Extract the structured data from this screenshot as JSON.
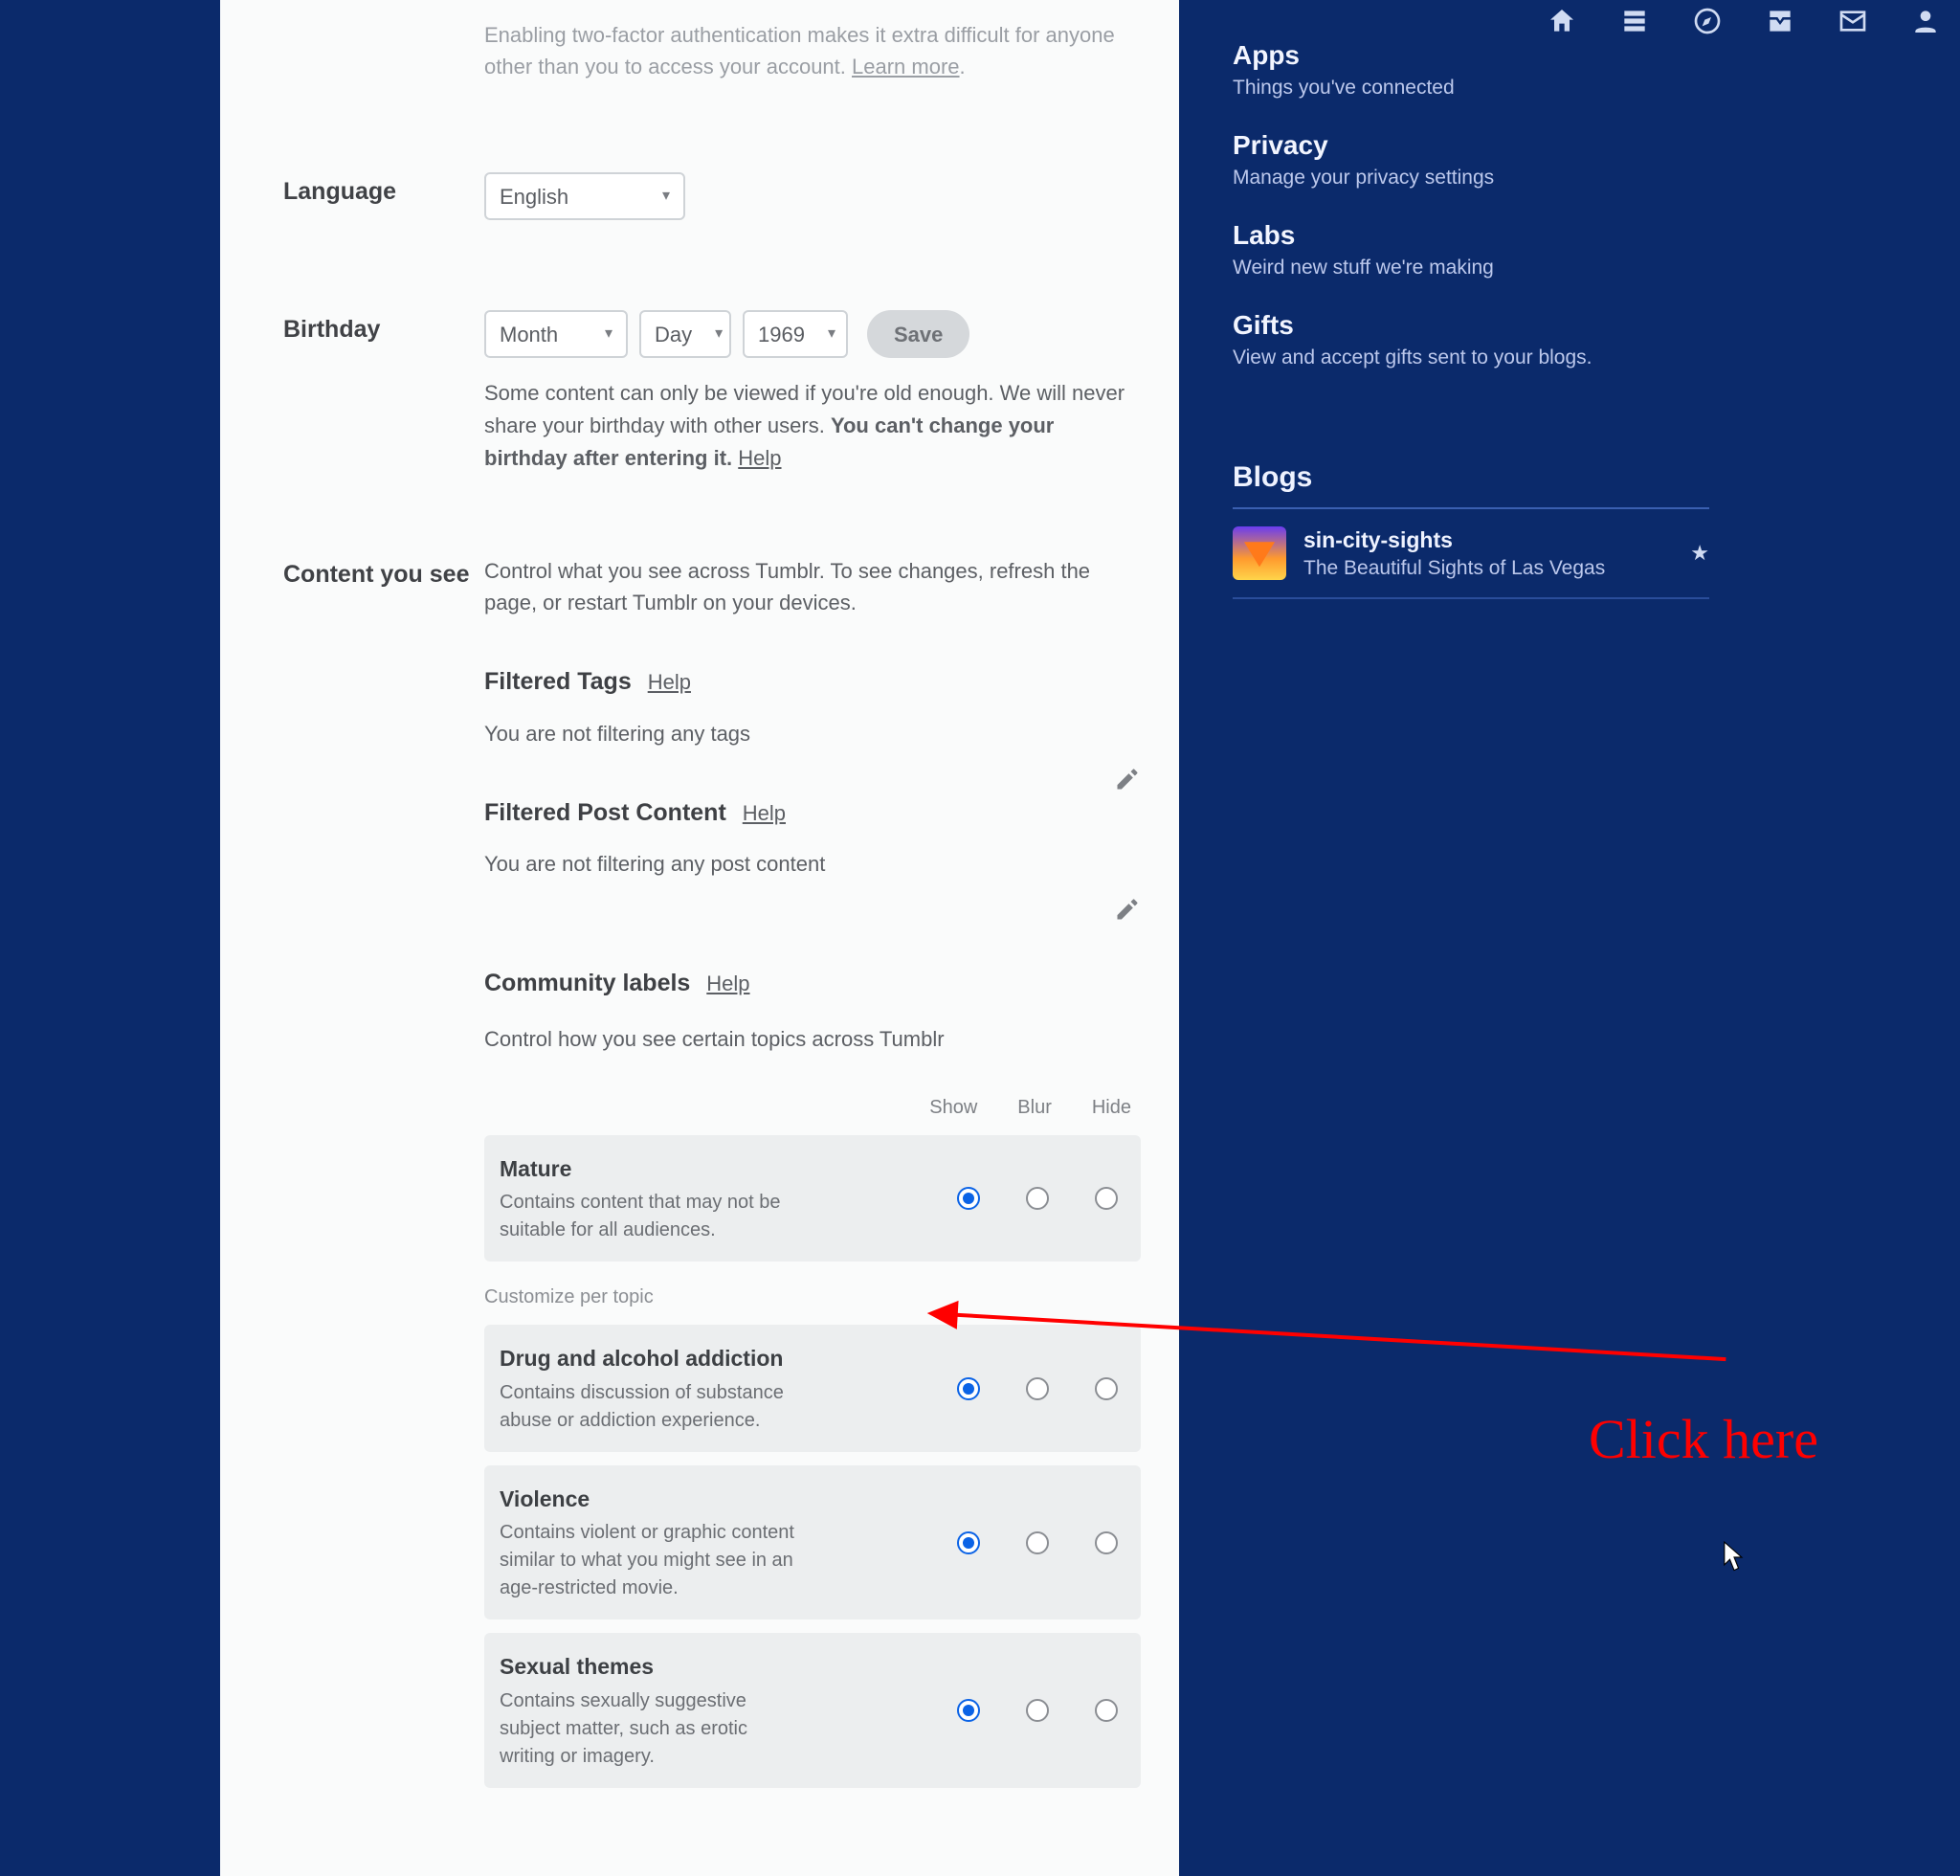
{
  "topbar": {
    "icons": [
      "home-icon",
      "explore-icon",
      "compass-icon",
      "inbox-icon",
      "mail-icon",
      "account-icon"
    ]
  },
  "two_factor": {
    "text_a": "Enabling two-factor authentication makes it extra difficult for anyone other than you to access your account. ",
    "learn_more": "Learn more"
  },
  "language": {
    "label": "Language",
    "value": "English"
  },
  "birthday": {
    "label": "Birthday",
    "month": "Month",
    "day": "Day",
    "year": "1969",
    "save": "Save",
    "note_a": "Some content can only be viewed if you're old enough. We will never share your birthday with other users. ",
    "note_b": "You can't change your birthday after entering it. ",
    "help": "Help"
  },
  "content": {
    "label": "Content you see",
    "intro": "Control what you see across Tumblr. To see changes, refresh the page, or restart Tumblr on your devices.",
    "filtered_tags": {
      "title": "Filtered Tags",
      "help": "Help",
      "status": "You are not filtering any tags"
    },
    "filtered_posts": {
      "title": "Filtered Post Content",
      "help": "Help",
      "status": "You are not filtering any post content"
    },
    "community": {
      "title": "Community labels",
      "help": "Help",
      "sub": "Control how you see certain topics across Tumblr",
      "cols": {
        "show": "Show",
        "blur": "Blur",
        "hide": "Hide"
      },
      "customize": "Customize per topic",
      "rows": [
        {
          "title": "Mature",
          "desc": "Contains content that may not be suitable for all audiences.",
          "sel": 0
        },
        {
          "title": "Drug and alcohol addiction",
          "desc": "Contains discussion of substance abuse or addiction experience.",
          "sel": 0
        },
        {
          "title": "Violence",
          "desc": "Contains violent or graphic content similar to what you might see in an age-restricted movie.",
          "sel": 0
        },
        {
          "title": "Sexual themes",
          "desc": "Contains sexually suggestive subject matter, such as erotic writing or imagery.",
          "sel": 0
        }
      ]
    }
  },
  "sidebar": {
    "items": [
      {
        "title": "Apps",
        "sub": "Things you've connected"
      },
      {
        "title": "Privacy",
        "sub": "Manage your privacy settings"
      },
      {
        "title": "Labs",
        "sub": "Weird new stuff we're making"
      },
      {
        "title": "Gifts",
        "sub": "View and accept gifts sent to your blogs."
      }
    ],
    "blogs_head": "Blogs",
    "blog": {
      "name": "sin-city-sights",
      "sub": "The Beautiful Sights of Las Vegas"
    }
  },
  "annotation": {
    "text": "Click here"
  }
}
